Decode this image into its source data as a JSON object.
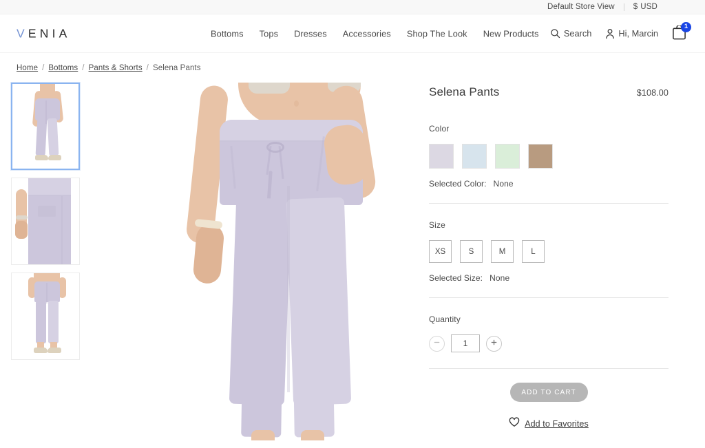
{
  "utility": {
    "store_view": "Default Store View",
    "currency_symbol": "$",
    "currency_code": "USD"
  },
  "header": {
    "logo": "VENIA",
    "logo_first_letter": "V",
    "logo_rest": "ENIA",
    "nav": [
      {
        "label": "Bottoms"
      },
      {
        "label": "Tops"
      },
      {
        "label": "Dresses"
      },
      {
        "label": "Accessories"
      },
      {
        "label": "Shop The Look"
      },
      {
        "label": "New Products"
      }
    ],
    "search_label": "Search",
    "account_label": "Hi, Marcin",
    "cart_count": "1"
  },
  "breadcrumb": {
    "items": [
      {
        "label": "Home",
        "link": true
      },
      {
        "label": "Bottoms",
        "link": true
      },
      {
        "label": "Pants & Shorts",
        "link": true
      },
      {
        "label": "Selena Pants",
        "link": false
      }
    ],
    "separator": "/"
  },
  "gallery": {
    "thumbnails": [
      {
        "alt": "Selena Pants front full view",
        "selected": true
      },
      {
        "alt": "Selena Pants hip and pocket detail",
        "selected": false
      },
      {
        "alt": "Selena Pants back view",
        "selected": false
      }
    ],
    "main_alt": "Selena Pants lavender, worn front view"
  },
  "product": {
    "title": "Selena Pants",
    "price": "$108.00",
    "color": {
      "label": "Color",
      "selected_label": "Selected Color:",
      "selected_value": "None",
      "swatches": [
        {
          "name": "lavender",
          "hex": "#dcd8e3"
        },
        {
          "name": "light-blue",
          "hex": "#d7e4ed"
        },
        {
          "name": "mint-green",
          "hex": "#daeed9"
        },
        {
          "name": "tan",
          "hex": "#b89b80"
        }
      ]
    },
    "size": {
      "label": "Size",
      "selected_label": "Selected Size:",
      "selected_value": "None",
      "options": [
        {
          "label": "XS"
        },
        {
          "label": "S"
        },
        {
          "label": "M"
        },
        {
          "label": "L"
        }
      ]
    },
    "quantity": {
      "label": "Quantity",
      "value": "1",
      "decrement_icon": "minus-icon",
      "increment_icon": "plus-icon"
    },
    "add_to_cart_label": "ADD TO CART",
    "favorites_label": "Add to Favorites"
  },
  "colors": {
    "accent_blue": "#1a46e5",
    "logo_blue": "#7694d4",
    "selected_thumb_border": "#8ab4f0",
    "disabled_button": "#b6b6b6",
    "utility_bar_bg": "#f8f8f8"
  }
}
